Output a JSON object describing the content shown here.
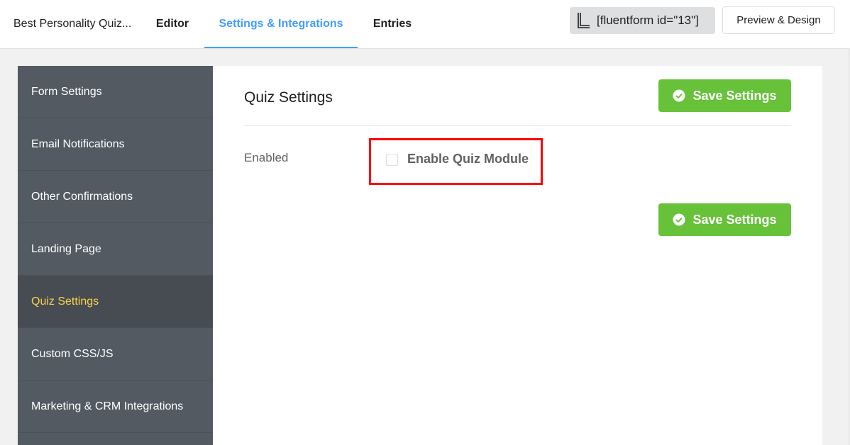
{
  "header": {
    "form_title": "Best Personality Quiz...",
    "tabs": [
      {
        "label": "Editor"
      },
      {
        "label": "Settings & Integrations"
      },
      {
        "label": "Entries"
      }
    ],
    "shortcode": "[fluentform id=\"13\"]",
    "preview_label": "Preview & Design"
  },
  "sidebar": {
    "items": [
      {
        "label": "Form Settings"
      },
      {
        "label": "Email Notifications"
      },
      {
        "label": "Other Confirmations"
      },
      {
        "label": "Landing Page"
      },
      {
        "label": "Quiz Settings"
      },
      {
        "label": "Custom CSS/JS"
      },
      {
        "label": "Marketing & CRM Integrations"
      }
    ],
    "active_index": 4
  },
  "main": {
    "title": "Quiz Settings",
    "save_label": "Save Settings",
    "field_label": "Enabled",
    "checkbox_label": "Enable Quiz Module",
    "checkbox_checked": false
  },
  "colors": {
    "accent": "#409eff",
    "save_green": "#67c23a",
    "sidebar_bg": "#535a61",
    "active_text": "#ffd04b",
    "highlight": "#ff0000"
  },
  "icons": {
    "shortcode": "clipboard-icon",
    "save": "check-circle-icon"
  }
}
